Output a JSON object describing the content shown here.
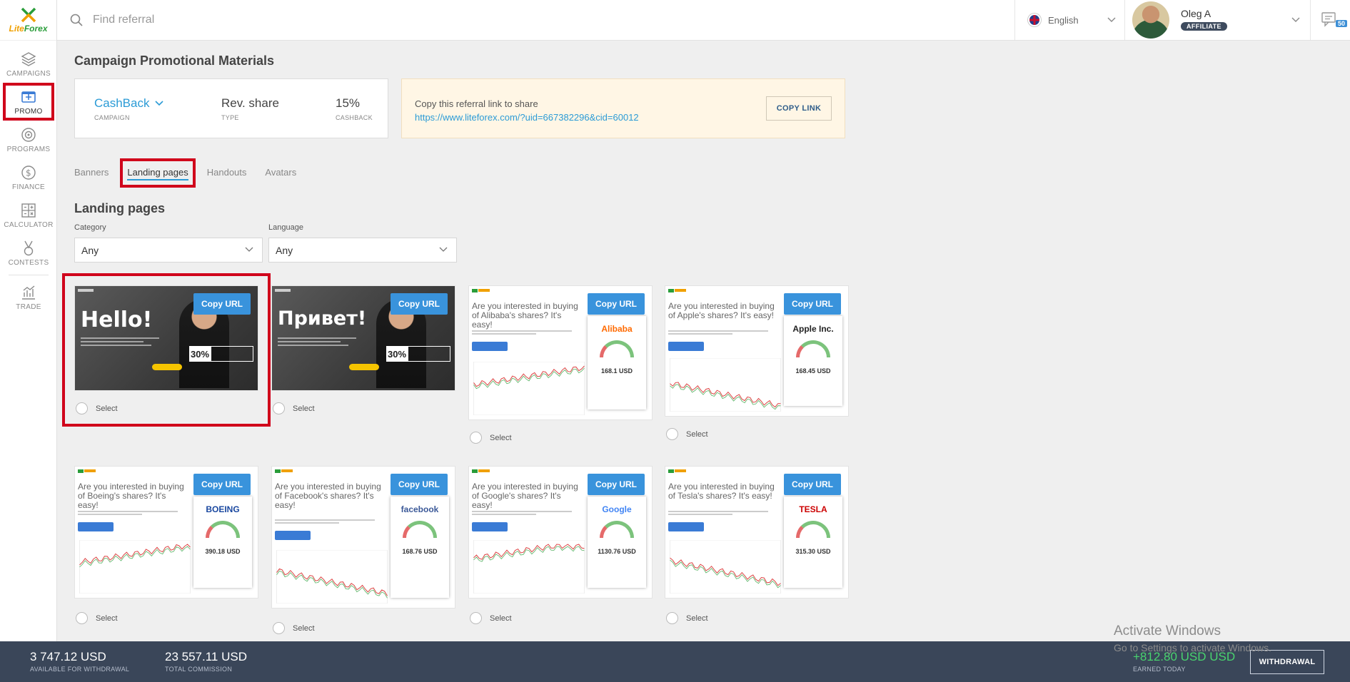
{
  "app": {
    "logo_text_a": "Lite",
    "logo_text_b": "Forex"
  },
  "sidebar": {
    "items": [
      {
        "label": "CAMPAIGNS",
        "icon": "layers-icon"
      },
      {
        "label": "PROMO",
        "icon": "promo-icon",
        "active": true
      },
      {
        "label": "PROGRAMS",
        "icon": "target-icon"
      },
      {
        "label": "FINANCE",
        "icon": "dollar-icon"
      },
      {
        "label": "CALCULATOR",
        "icon": "calculator-icon"
      },
      {
        "label": "CONTESTS",
        "icon": "medal-icon"
      },
      {
        "label": "TRADE",
        "icon": "chart-icon"
      }
    ]
  },
  "header": {
    "search_placeholder": "Find referral",
    "language": "English",
    "user_name": "Oleg A",
    "user_role": "AFFILIATE",
    "messages_count": "50"
  },
  "main": {
    "title": "Campaign Promotional Materials",
    "campaign": {
      "name": "CashBack",
      "name_label": "CAMPAIGN",
      "type": "Rev. share",
      "type_label": "TYPE",
      "cashback": "15%",
      "cashback_label": "CASHBACK"
    },
    "referral": {
      "title": "Copy this referral link to share",
      "link": "https://www.liteforex.com/?uid=667382296&cid=60012",
      "button": "COPY LINK"
    },
    "tabs": [
      "Banners",
      "Landing pages",
      "Handouts",
      "Avatars"
    ],
    "active_tab": "Landing pages",
    "section_title": "Landing pages",
    "filters": {
      "category_label": "Category",
      "category_value": "Any",
      "language_label": "Language",
      "language_value": "Any"
    },
    "copy_url_label": "Copy URL",
    "select_label": "Select",
    "cards": [
      {
        "kind": "hero",
        "word": "Hello!",
        "percent": "30%"
      },
      {
        "kind": "hero",
        "word": "Привет!",
        "percent": "30%"
      },
      {
        "kind": "stock",
        "headline": "Are you interested in buying of Alibaba's shares? It's easy!",
        "company": "Alibaba",
        "price": "168.1 USD"
      },
      {
        "kind": "stock",
        "headline": "Are you interested in buying of Apple's shares? It's easy!",
        "company": "Apple Inc.",
        "price": "168.45 USD"
      },
      {
        "kind": "stock",
        "headline": "Are you interested in buying of Boeing's shares? It's easy!",
        "company": "BOEING",
        "price": "390.18 USD"
      },
      {
        "kind": "stock",
        "headline": "Are you interested in buying of Facebook's shares? It's easy!",
        "company": "facebook",
        "price": "168.76 USD"
      },
      {
        "kind": "stock",
        "headline": "Are you interested in buying of Google's shares? It's easy!",
        "company": "Google",
        "price": "1130.76 USD"
      },
      {
        "kind": "stock",
        "headline": "Are you interested in buying of Tesla's shares? It's easy!",
        "company": "TESLA",
        "price": "315.30 USD"
      }
    ]
  },
  "footer": {
    "available": "3 747.12 USD",
    "available_label": "AVAILABLE FOR WITHDRAWAL",
    "commission": "23 557.11 USD",
    "commission_label": "TOTAL COMMISSION",
    "earned": "+812.80 USD USD",
    "earned_label": "EARNED TODAY",
    "withdraw_button": "WITHDRAWAL"
  },
  "watermark": {
    "line1": "Activate Windows",
    "line2": "Go to Settings to activate Windows."
  },
  "colors": {
    "accent": "#2b9bd6",
    "button_blue": "#3993dc",
    "footer_bg": "#3a4659",
    "highlight_red": "#d0021b",
    "positive": "#49d36e"
  }
}
